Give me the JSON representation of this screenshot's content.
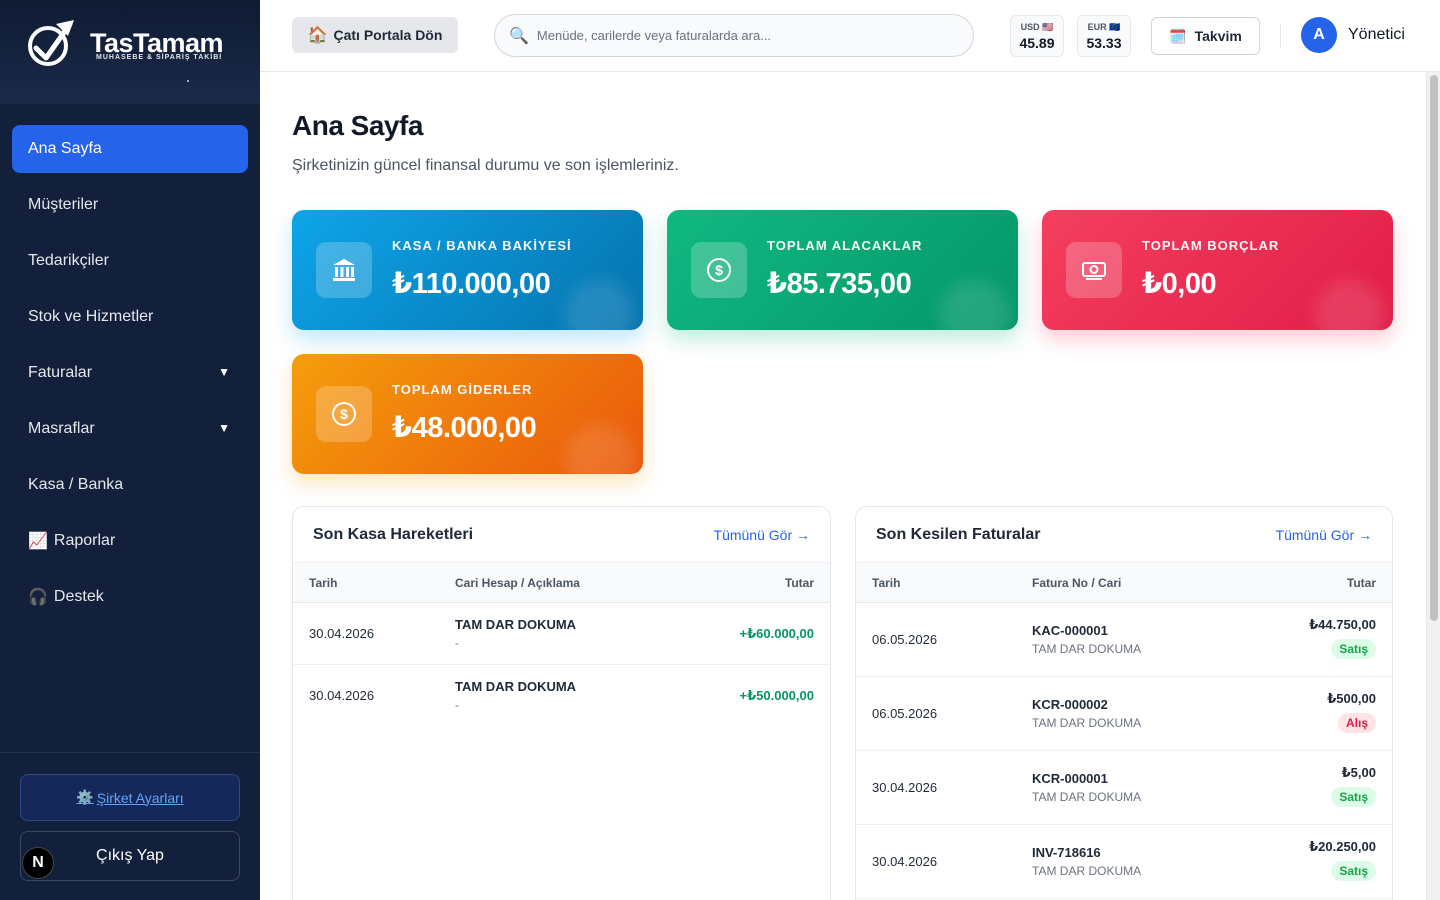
{
  "brand": {
    "title": "TasTamam",
    "subtitle": "MUHASEBE & SİPARİŞ TAKİBİ"
  },
  "sidebar": {
    "items": [
      {
        "label": "Ana Sayfa",
        "icon": "",
        "active": true,
        "has_caret": false
      },
      {
        "label": "Müşteriler",
        "icon": "",
        "active": false,
        "has_caret": false
      },
      {
        "label": "Tedarikçiler",
        "icon": "",
        "active": false,
        "has_caret": false
      },
      {
        "label": "Stok ve Hizmetler",
        "icon": "",
        "active": false,
        "has_caret": false
      },
      {
        "label": "Faturalar",
        "icon": "",
        "active": false,
        "has_caret": true
      },
      {
        "label": "Masraflar",
        "icon": "",
        "active": false,
        "has_caret": true
      },
      {
        "label": "Kasa / Banka",
        "icon": "",
        "active": false,
        "has_caret": false
      },
      {
        "label": "Raporlar",
        "icon": "📈",
        "active": false,
        "has_caret": false
      },
      {
        "label": "Destek",
        "icon": "🎧",
        "active": false,
        "has_caret": false
      }
    ],
    "caret": "▼",
    "settings_label": "Şirket Ayarları",
    "settings_icon": "⚙️",
    "logout_label": "Çıkış Yap",
    "n_badge": "N"
  },
  "header": {
    "portal_label": "Çatı Portala Dön",
    "portal_icon": "🏠",
    "search_icon": "🔍",
    "search_placeholder": "Menüde, carilerde veya faturalarda ara...",
    "rates": [
      {
        "label": "USD 🇺🇸",
        "value": "45.89"
      },
      {
        "label": "EUR 🇪🇺",
        "value": "53.33"
      }
    ],
    "calendar_label": "Takvim",
    "calendar_icon": "🗓️",
    "avatar_letter": "A",
    "user_name": "Yönetici"
  },
  "page": {
    "title": "Ana Sayfa",
    "subtitle": "Şirketinizin güncel finansal durumu ve son işlemleriniz."
  },
  "cards": [
    {
      "label": "KASA / BANKA BAKİYESİ",
      "value": "₺110.000,00",
      "icon": "bank-icon",
      "color": "#0ea5e9"
    },
    {
      "label": "TOPLAM ALACAKLAR",
      "value": "₺85.735,00",
      "icon": "dollar-icon",
      "color": "#10b981"
    },
    {
      "label": "TOPLAM BORÇLAR",
      "value": "₺0,00",
      "icon": "money-icon",
      "color": "#f43f5e"
    },
    {
      "label": "TOPLAM GİDERLER",
      "value": "₺48.000,00",
      "icon": "dollar-icon",
      "color": "#f59e0b"
    }
  ],
  "cash_panel": {
    "title": "Son Kasa Hareketleri",
    "link": "Tümünü Gör →",
    "columns": [
      "Tarih",
      "Cari Hesap / Açıklama",
      "Tutar"
    ],
    "rows": [
      {
        "date": "30.04.2026",
        "account": "TAM DAR DOKUMA",
        "desc": "-",
        "amount": "+₺60.000,00"
      },
      {
        "date": "30.04.2026",
        "account": "TAM DAR DOKUMA",
        "desc": "-",
        "amount": "+₺50.000,00"
      }
    ]
  },
  "invoice_panel": {
    "title": "Son Kesilen Faturalar",
    "link": "Tümünü Gör →",
    "columns": [
      "Tarih",
      "Fatura No / Cari",
      "Tutar"
    ],
    "rows": [
      {
        "date": "06.05.2026",
        "no": "KAC-000001",
        "account": "TAM DAR DOKUMA",
        "amount": "₺44.750,00",
        "type": "Satış",
        "kind": "sale"
      },
      {
        "date": "06.05.2026",
        "no": "KCR-000002",
        "account": "TAM DAR DOKUMA",
        "amount": "₺500,00",
        "type": "Alış",
        "kind": "buy"
      },
      {
        "date": "30.04.2026",
        "no": "KCR-000001",
        "account": "TAM DAR DOKUMA",
        "amount": "₺5,00",
        "type": "Satış",
        "kind": "sale"
      },
      {
        "date": "30.04.2026",
        "no": "INV-718616",
        "account": "TAM DAR DOKUMA",
        "amount": "₺20.250,00",
        "type": "Satış",
        "kind": "sale"
      }
    ]
  }
}
